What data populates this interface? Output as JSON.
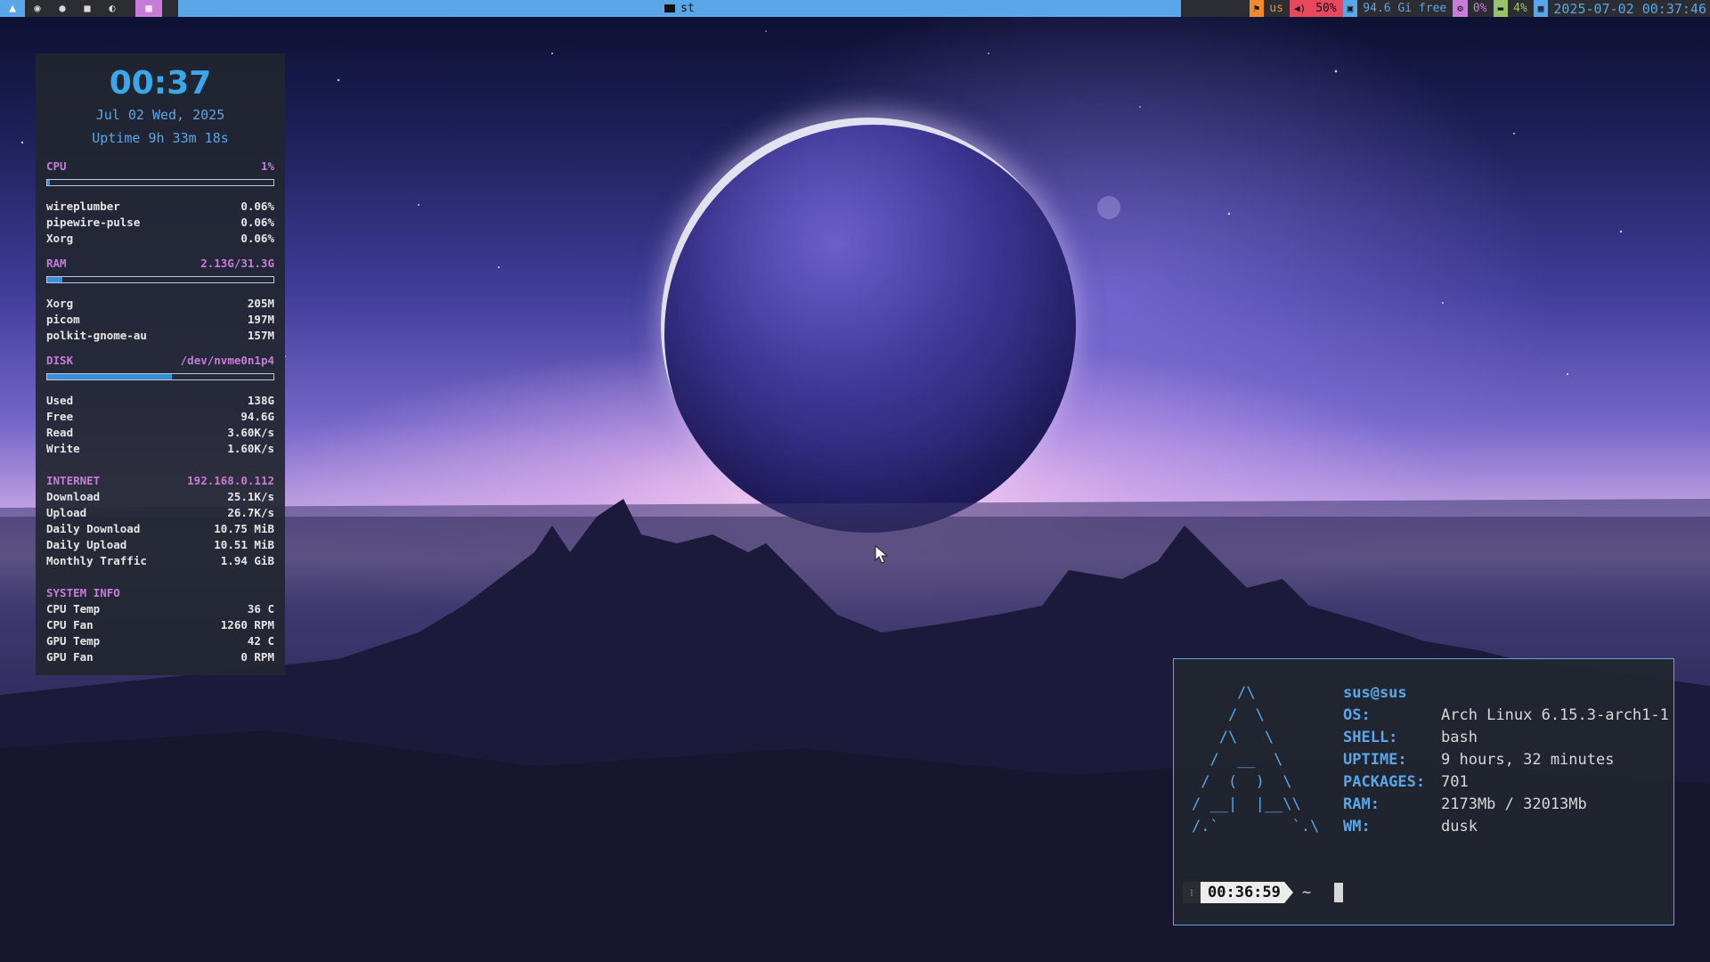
{
  "topbar": {
    "launcher_icon": "arch-logo-icon",
    "tags": [
      {
        "icon": "chrome-icon"
      },
      {
        "icon": "github-icon"
      },
      {
        "icon": "folder-icon"
      },
      {
        "icon": "steam-icon"
      },
      {
        "icon": "table-icon",
        "active": true
      }
    ],
    "window_title": "st",
    "keyboard": "us",
    "volume": "50%",
    "disk": "94.6 Gi free",
    "cpu": "0%",
    "memory": "4%",
    "datetime": "2025-07-02 00:37:46",
    "colors": {
      "accent": "#5aa6e8",
      "purple": "#c77dd8",
      "orange": "#ef8a2e",
      "red": "#e8475e",
      "green": "#98c36a"
    }
  },
  "conky": {
    "time": "00:37",
    "date": "Jul 02 Wed, 2025",
    "uptime": "Uptime 9h 33m 18s",
    "cpu": {
      "label": "CPU",
      "value": "1%",
      "level": 0.01,
      "procs": [
        {
          "name": "wireplumber",
          "value": "0.06%"
        },
        {
          "name": "pipewire-pulse",
          "value": "0.06%"
        },
        {
          "name": "Xorg",
          "value": "0.06%"
        }
      ]
    },
    "ram": {
      "label": "RAM",
      "value": "2.13G/31.3G",
      "level": 0.068,
      "procs": [
        {
          "name": "Xorg",
          "value": "205M"
        },
        {
          "name": "picom",
          "value": "197M"
        },
        {
          "name": "polkit-gnome-au",
          "value": "157M"
        }
      ]
    },
    "disk": {
      "label": "DISK",
      "device": "/dev/nvme0n1p4",
      "level": 0.55,
      "rows": [
        {
          "name": "Used",
          "value": "138G"
        },
        {
          "name": "Free",
          "value": "94.6G"
        },
        {
          "name": "Read",
          "value": "3.60K/s"
        },
        {
          "name": "Write",
          "value": "1.60K/s"
        }
      ]
    },
    "internet": {
      "label": "INTERNET",
      "ip": "192.168.0.112",
      "rows": [
        {
          "name": "Download",
          "value": "25.1K/s"
        },
        {
          "name": "Upload",
          "value": "26.7K/s"
        },
        {
          "name": "Daily Download",
          "value": "10.75 MiB"
        },
        {
          "name": "Daily Upload",
          "value": "10.51 MiB"
        },
        {
          "name": "Monthly Traffic",
          "value": "1.94 GiB"
        }
      ]
    },
    "sysinfo": {
      "label": "SYSTEM INFO",
      "rows": [
        {
          "name": "CPU Temp",
          "value": "36 C"
        },
        {
          "name": "CPU Fan",
          "value": "1260 RPM"
        },
        {
          "name": "GPU Temp",
          "value": "42 C"
        },
        {
          "name": "GPU Fan",
          "value": "0 RPM"
        }
      ]
    }
  },
  "terminal": {
    "ascii_art": "     /\\\n    /  \\\n   /\\   \\\n  /  __  \\\n /  (  )  \\\n/ __|  |__\\\\\n/.`        `.\\",
    "user": "sus@sus",
    "info": [
      {
        "key": "OS:",
        "value": "Arch Linux 6.15.3-arch1-1"
      },
      {
        "key": "SHELL:",
        "value": "bash"
      },
      {
        "key": "UPTIME:",
        "value": "9 hours, 32 minutes"
      },
      {
        "key": "PACKAGES:",
        "value": "701"
      },
      {
        "key": "RAM:",
        "value": "2173Mb / 32013Mb"
      },
      {
        "key": "WM:",
        "value": "dusk"
      }
    ],
    "prompt_time": "00:36:59",
    "prompt_dir": "~"
  }
}
